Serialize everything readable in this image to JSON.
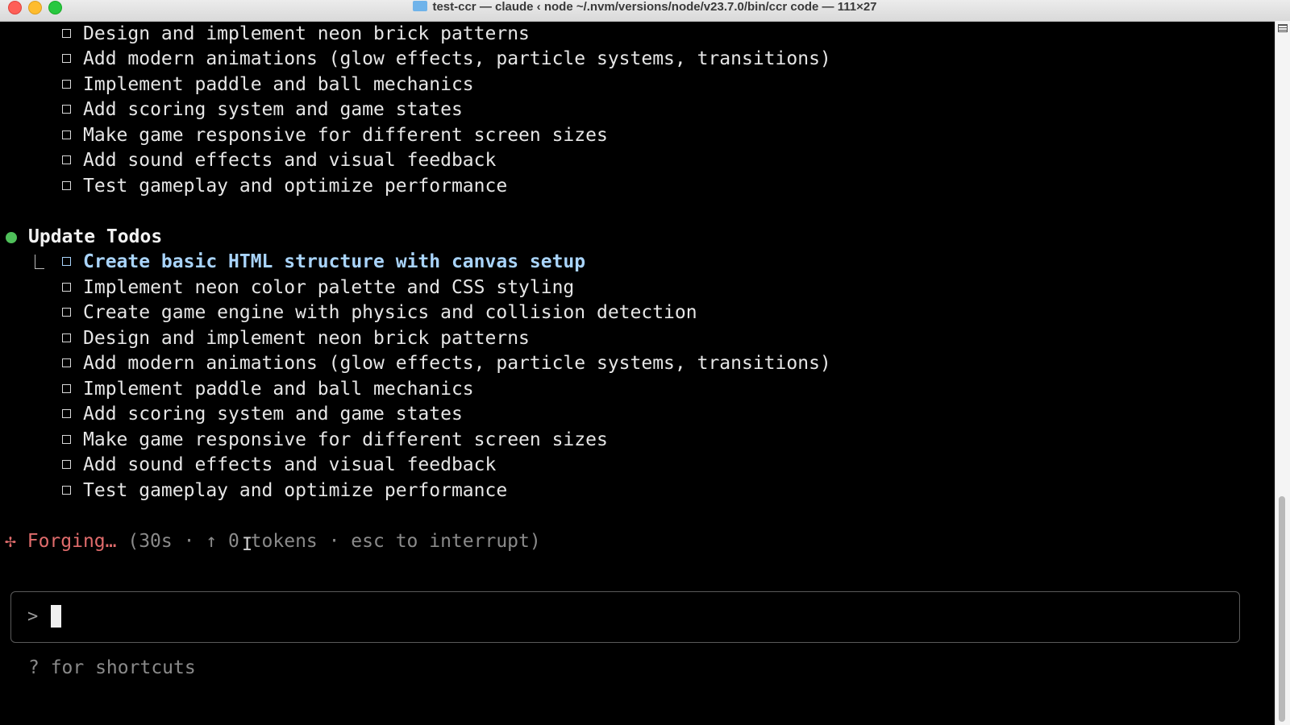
{
  "window": {
    "title": "test-ccr — claude ‹ node ~/.nvm/versions/node/v23.7.0/bin/ccr code — 111×27",
    "title_icon": "folder-icon"
  },
  "previous_todos": [
    "Design and implement neon brick patterns",
    "Add modern animations (glow effects, particle systems, transitions)",
    "Implement paddle and ball mechanics",
    "Add scoring system and game states",
    "Make game responsive for different screen sizes",
    "Add sound effects and visual feedback",
    "Test gameplay and optimize performance"
  ],
  "update_todos": {
    "title": "Update Todos",
    "bullet_color": "#4fc05a",
    "items": [
      "Create basic HTML structure with canvas setup",
      "Implement neon color palette and CSS styling",
      "Create game engine with physics and collision detection",
      "Design and implement neon brick patterns",
      "Add modern animations (glow effects, particle systems, transitions)",
      "Implement paddle and ball mechanics",
      "Add scoring system and game states",
      "Make game responsive for different screen sizes",
      "Add sound effects and visual feedback",
      "Test gameplay and optimize performance"
    ],
    "current_color": "#a9d4fb"
  },
  "status": {
    "spark": "✢",
    "label": "Forging…",
    "meta": "(30s · ↑ 0 tokens · esc to interrupt)",
    "label_color": "#e06c6c"
  },
  "input": {
    "prompt": ">",
    "value": ""
  },
  "footer": {
    "hint": "? for shortcuts"
  }
}
